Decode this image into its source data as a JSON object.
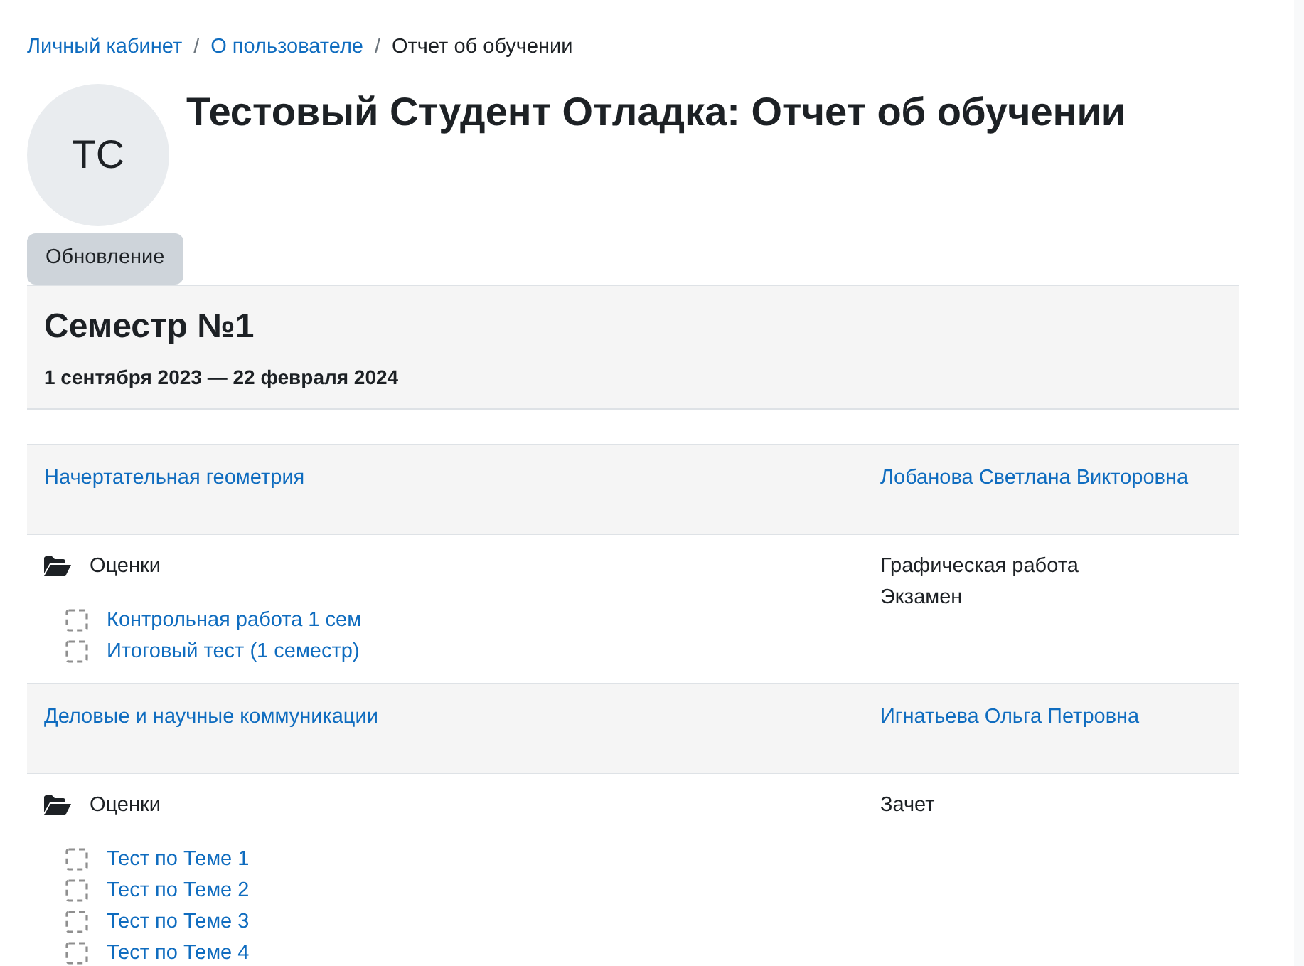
{
  "breadcrumbs": [
    {
      "label": "Личный кабинет",
      "link": true
    },
    {
      "label": "О пользователе",
      "link": true
    },
    {
      "label": "Отчет об обучении",
      "link": false
    }
  ],
  "breadcrumb_separator": "/",
  "avatar": {
    "initials": "ТС"
  },
  "title": "Тестовый Студент Отладка: Отчет об обучении",
  "update_button": "Обновление",
  "semester": {
    "title": "Семестр №1",
    "dates": "1 сентября 2023 — 22 февраля 2024"
  },
  "courses": [
    {
      "name": "Начертательная геометрия",
      "teacher": "Лобанова Светлана Викторовна",
      "grades_label": "Оценки",
      "items": [
        "Контрольная работа 1 сем",
        "Итоговый тест (1 семестр)"
      ],
      "assessments": [
        "Графическая работа",
        "Экзамен"
      ]
    },
    {
      "name": "Деловые и научные коммуникации",
      "teacher": "Игнатьева Ольга Петровна",
      "grades_label": "Оценки",
      "items": [
        "Тест по Теме 1",
        "Тест по Теме 2",
        "Тест по Теме 3",
        "Тест по Теме 4"
      ],
      "assessments": [
        "Зачет"
      ]
    }
  ]
}
